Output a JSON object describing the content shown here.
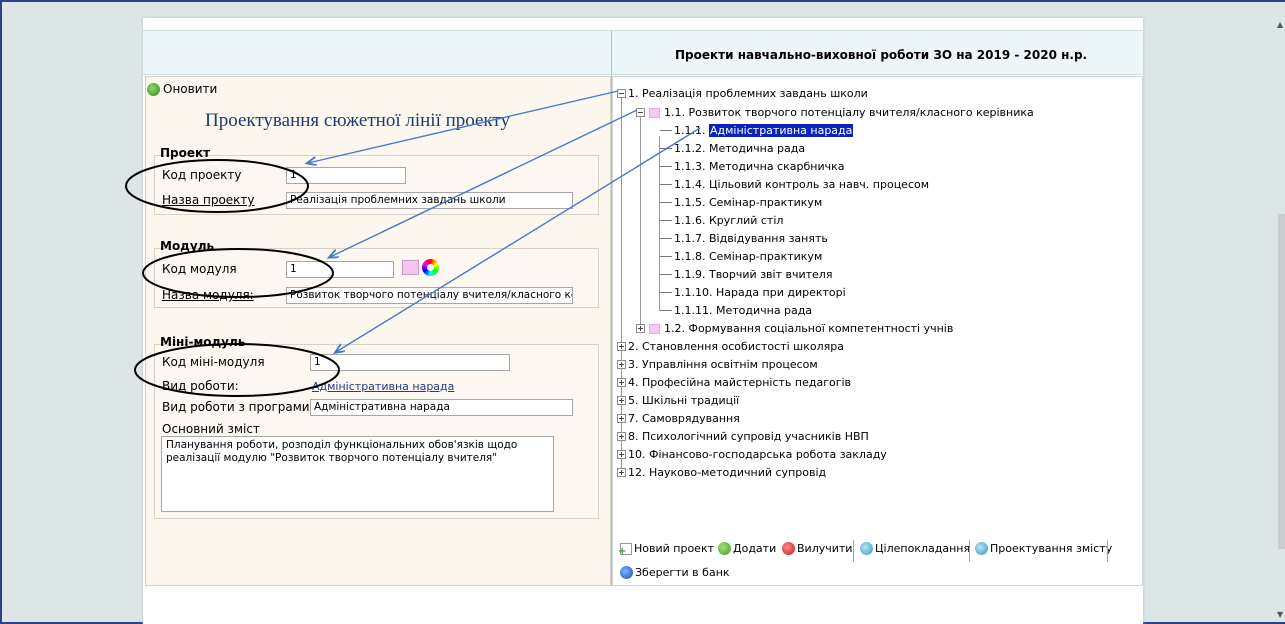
{
  "header": {
    "title": "Проекти навчально-виховної роботи ЗО на 2019 - 2020 н.р."
  },
  "left": {
    "refresh_label": "Оновити",
    "design_title": "Проектування сюжетної лінії проекту",
    "project": {
      "section_title": "Проект",
      "code_label": "Код проекту",
      "code_value": "1",
      "name_label": "Назва проекту",
      "name_value": "Реалізація проблемних завдань школи"
    },
    "module": {
      "section_title": "Модуль",
      "code_label": "Код модуля",
      "code_value": "1",
      "name_label": "Назва модуля:",
      "name_value": "Розвиток творчого потенціалу вчителя/класного керівн"
    },
    "minimodule": {
      "section_title": "Міні-модуль",
      "code_label": "Код міні-модуля",
      "code_value": "1",
      "worktype_label": "Вид роботи:",
      "worktype_value": "Адміністративна нарада",
      "worktype_prog_label": "Вид роботи з програми:",
      "worktype_prog_value": "Адміністративна нарада",
      "content_label": "Основний зміст",
      "content_value": "Планування роботи, розподіл функціональних обов'язків щодо реалізації модулю \"Розвиток творчого потенціалу вчителя\""
    }
  },
  "tree": {
    "root1": "1. Реалізація проблемних завдань школи",
    "child11": "1.1. Розвиток творчого потенціалу вчителя/класного керівника",
    "leaf_prefix": "1.1.1.",
    "leaf_selected": "Адміністративна нарада",
    "leaves": [
      "1.1.2. Методична рада",
      "1.1.3. Методична скарбничка",
      "1.1.4. Цільовий контроль за навч. процесом",
      "1.1.5. Семінар-практикум",
      "1.1.6. Круглий стіл",
      "1.1.7. Відвідування занять",
      "1.1.8. Семінар-практикум",
      "1.1.9. Творчий звіт вчителя",
      "1.1.10. Нарада при директорі",
      "1.1.11. Методична рада"
    ],
    "child12": "1.2. Формування соціальної компетентності учнів",
    "roots": [
      "2. Становлення особистості школяра",
      "3. Управління освітнім процесом",
      "4. Професійна майстерність педагогів",
      "5. Шкільні традиції",
      "7. Самоврядування",
      "8. Психологічний супровід учасників НВП",
      "10. Фінансово-господарська робота закладу",
      "12. Науково-методичний супровід"
    ]
  },
  "toolbar": {
    "new_project": "Новий проект",
    "add": "Додати",
    "remove": "Вилучити",
    "goal": "Цілепокладання",
    "content_design": "Проектування змісту",
    "save_bank": "Зберегти в банк"
  },
  "colors": {
    "selection": "#0a24b8",
    "arrow": "#4a78c8",
    "swatch": "#f6c6f0"
  }
}
